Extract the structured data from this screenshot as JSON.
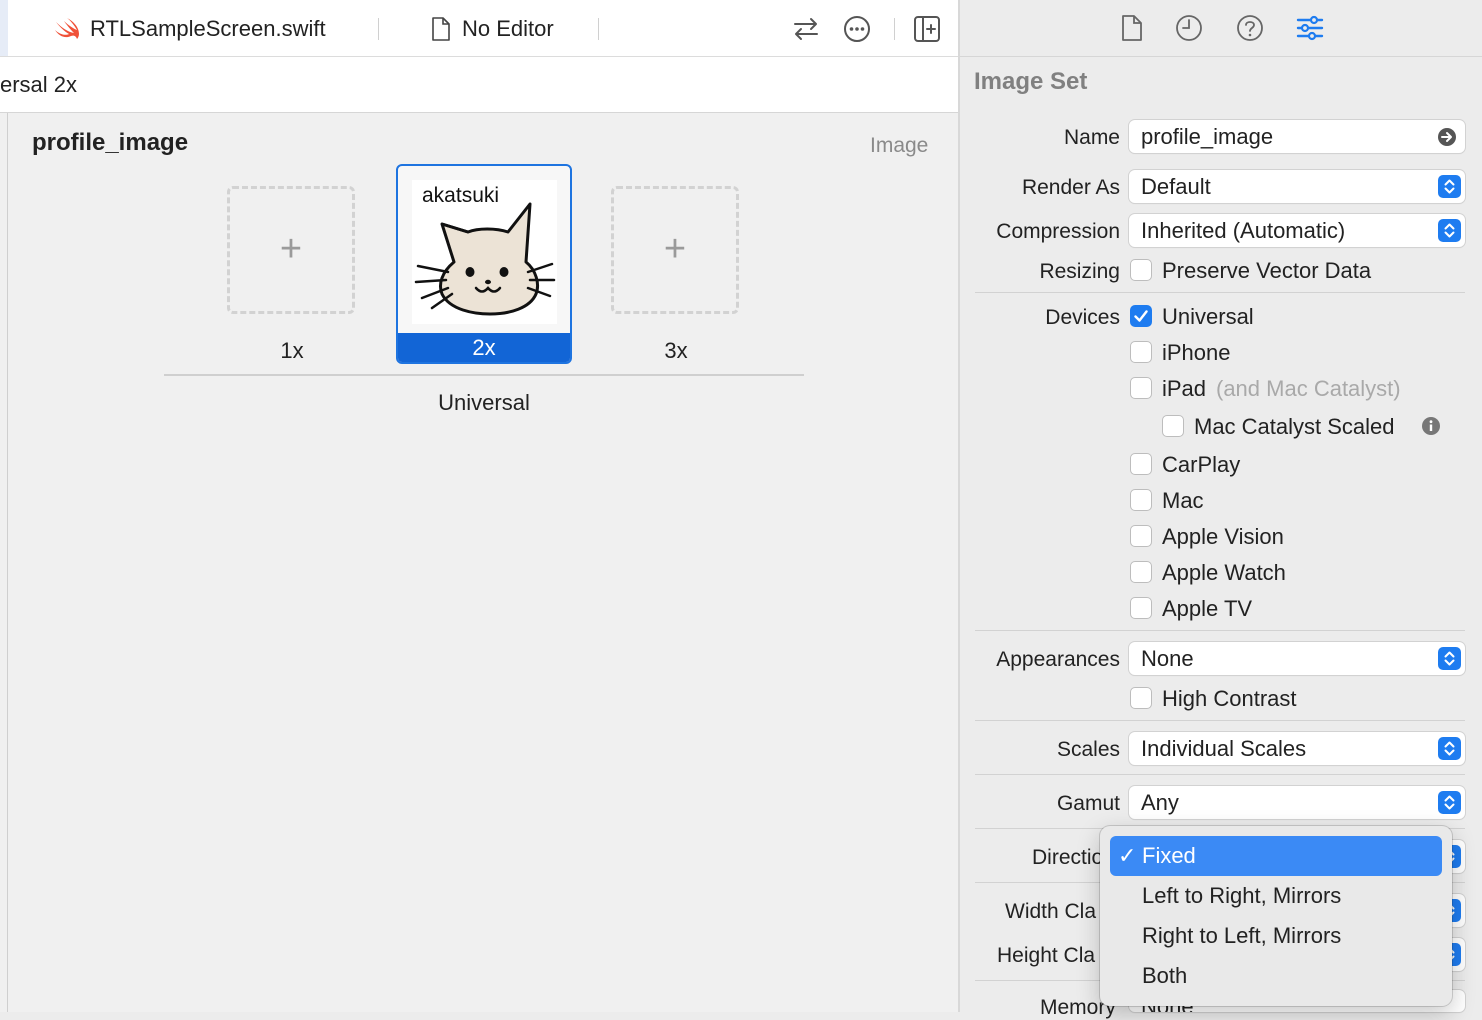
{
  "tabs": {
    "swift_file": "RTLSampleScreen.swift",
    "no_editor": "No Editor"
  },
  "jumpbar": {
    "text": "ersal 2x"
  },
  "asset": {
    "name": "profile_image",
    "type": "Image",
    "slots": [
      {
        "label": "1x",
        "empty": true
      },
      {
        "label": "2x",
        "empty": false,
        "selected": true,
        "image_caption": "akatsuki"
      },
      {
        "label": "3x",
        "empty": true
      }
    ],
    "group_label": "Universal"
  },
  "inspector": {
    "section_title": "Image Set",
    "name_label": "Name",
    "name_value": "profile_image",
    "render_as_label": "Render As",
    "render_as_value": "Default",
    "compression_label": "Compression",
    "compression_value": "Inherited (Automatic)",
    "resizing_label": "Resizing",
    "resizing_option": "Preserve Vector Data",
    "devices_label": "Devices",
    "devices": [
      {
        "label": "Universal",
        "checked": true
      },
      {
        "label": "iPhone",
        "checked": false
      },
      {
        "label": "iPad",
        "suffix": "(and Mac Catalyst)",
        "checked": false
      },
      {
        "label": "Mac Catalyst Scaled",
        "checked": false
      },
      {
        "label": "CarPlay",
        "checked": false
      },
      {
        "label": "Mac",
        "checked": false
      },
      {
        "label": "Apple Vision",
        "checked": false
      },
      {
        "label": "Apple Watch",
        "checked": false
      },
      {
        "label": "Apple TV",
        "checked": false
      }
    ],
    "appearances_label": "Appearances",
    "appearances_value": "None",
    "high_contrast": "High Contrast",
    "scales_label": "Scales",
    "scales_value": "Individual Scales",
    "gamut_label": "Gamut",
    "gamut_value": "Any",
    "direction_label": "Directio",
    "width_class_label": "Width Cla",
    "height_class_label": "Height Cla",
    "memory_label": "Memory",
    "memory_value": "None"
  },
  "direction_menu": {
    "options": [
      {
        "label": "Fixed",
        "selected": true
      },
      {
        "label": "Left to Right, Mirrors",
        "selected": false
      },
      {
        "label": "Right to Left, Mirrors",
        "selected": false
      },
      {
        "label": "Both",
        "selected": false
      }
    ],
    "check_glyph": "✓"
  },
  "colors": {
    "accent": "#1e7cf0",
    "selection_bar": "#1265d6",
    "menu_highlight": "#3b8af5"
  },
  "icons": [
    "swift-icon",
    "document-icon",
    "swap-icon",
    "more-icon",
    "add-editor-icon",
    "file-inspector-icon",
    "history-icon",
    "help-icon",
    "attributes-inspector-icon",
    "go-arrow-icon",
    "info-icon",
    "popup-stepper-icon"
  ]
}
